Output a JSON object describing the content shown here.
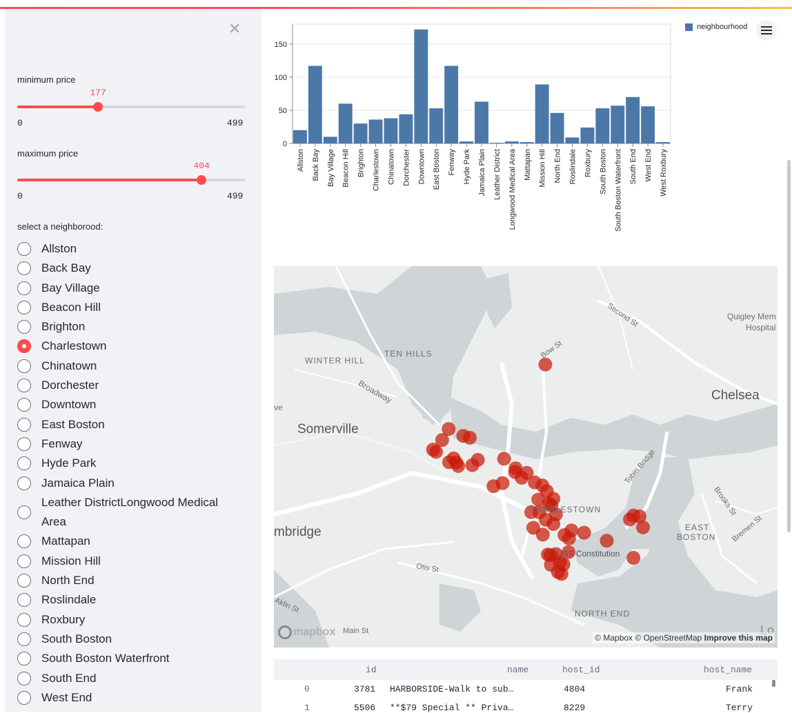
{
  "sidebar": {
    "close_icon": "close-x",
    "min_price": {
      "label": "minimum price",
      "value": 177,
      "min": 0,
      "max": 499,
      "value_text": "177",
      "min_text": "0",
      "max_text": "499"
    },
    "max_price": {
      "label": "maximum price",
      "value": 404,
      "min": 0,
      "max": 499,
      "value_text": "404",
      "min_text": "0",
      "max_text": "499"
    },
    "neighborhood_label": "select a neighborood:",
    "neighborhoods": [
      {
        "label": "Allston",
        "selected": false
      },
      {
        "label": "Back Bay",
        "selected": false
      },
      {
        "label": "Bay Village",
        "selected": false
      },
      {
        "label": "Beacon Hill",
        "selected": false
      },
      {
        "label": "Brighton",
        "selected": false
      },
      {
        "label": "Charlestown",
        "selected": true
      },
      {
        "label": "Chinatown",
        "selected": false
      },
      {
        "label": "Dorchester",
        "selected": false
      },
      {
        "label": "Downtown",
        "selected": false
      },
      {
        "label": "East Boston",
        "selected": false
      },
      {
        "label": "Fenway",
        "selected": false
      },
      {
        "label": "Hyde Park",
        "selected": false
      },
      {
        "label": "Jamaica Plain",
        "selected": false
      },
      {
        "label": "Leather DistrictLongwood Medical Area",
        "selected": false
      },
      {
        "label": "Mattapan",
        "selected": false
      },
      {
        "label": "Mission Hill",
        "selected": false
      },
      {
        "label": "North End",
        "selected": false
      },
      {
        "label": "Roslindale",
        "selected": false
      },
      {
        "label": "Roxbury",
        "selected": false
      },
      {
        "label": "South Boston",
        "selected": false
      },
      {
        "label": "South Boston Waterfront",
        "selected": false
      },
      {
        "label": "South End",
        "selected": false
      },
      {
        "label": "West End",
        "selected": false
      }
    ]
  },
  "chart_data": {
    "type": "bar",
    "categories": [
      "Allston",
      "Back Bay",
      "Bay Village",
      "Beacon Hill",
      "Brighton",
      "Charlestown",
      "Chinatown",
      "Dorchester",
      "Downtown",
      "East Boston",
      "Fenway",
      "Hyde Park",
      "Jamaica Plain",
      "Leather District",
      "Longwood Medical Area",
      "Mattapan",
      "Mission Hill",
      "North End",
      "Roslindale",
      "Roxbury",
      "South Boston",
      "South Boston Waterfront",
      "South End",
      "West End",
      "West Roxbury"
    ],
    "values": [
      20,
      117,
      10,
      60,
      30,
      36,
      38,
      44,
      172,
      53,
      117,
      3,
      63,
      1,
      3,
      2,
      89,
      46,
      9,
      24,
      53,
      57,
      70,
      56,
      2
    ],
    "yticks": [
      0,
      50,
      100,
      150
    ],
    "ylim": [
      0,
      180
    ],
    "legend": [
      "neighbourhood"
    ],
    "legend_position": "top-right",
    "color": "#4c78a8",
    "grid": true
  },
  "menu_icon": "hamburger-menu",
  "map": {
    "labels": {
      "tenhills": "TEN HILLS",
      "winterhill": "WINTER HILL",
      "broadway": "Broadway",
      "somerville": "Somerville",
      "bowst": "Bow St",
      "secondst": "Second St",
      "quigley1": "Quigley Mem",
      "quigley2": "Hospital",
      "chelsea": "Chelsea",
      "tobin": "Tobin Bridge",
      "charlestown": "CHARLESTOWN",
      "eastboston1": "EAST",
      "eastboston2": "BOSTON",
      "brooks": "Brooks St",
      "bremen": "Bremen St",
      "cambridge": "mbridge",
      "ussconst": "USS Constitution",
      "otis": "Otis St",
      "northend": "NORTH END",
      "mainst": "Main St",
      "klin": "Aklin St",
      "ve": "ve",
      "mapbox": "mapbox",
      "lo": "Lo"
    },
    "attribution": {
      "mapbox": "© Mapbox",
      "osm": "© OpenStreetMap",
      "improve": "Improve this map"
    },
    "point_color": "#c91a09",
    "points": [
      [
        0.539,
        0.258
      ],
      [
        0.347,
        0.427
      ],
      [
        0.334,
        0.456
      ],
      [
        0.316,
        0.481
      ],
      [
        0.322,
        0.487
      ],
      [
        0.376,
        0.445
      ],
      [
        0.389,
        0.45
      ],
      [
        0.348,
        0.514
      ],
      [
        0.362,
        0.515
      ],
      [
        0.366,
        0.524
      ],
      [
        0.357,
        0.504
      ],
      [
        0.394,
        0.522
      ],
      [
        0.405,
        0.508
      ],
      [
        0.457,
        0.505
      ],
      [
        0.48,
        0.53
      ],
      [
        0.479,
        0.54
      ],
      [
        0.502,
        0.542
      ],
      [
        0.492,
        0.555
      ],
      [
        0.436,
        0.577
      ],
      [
        0.454,
        0.569
      ],
      [
        0.518,
        0.567
      ],
      [
        0.533,
        0.575
      ],
      [
        0.542,
        0.59
      ],
      [
        0.525,
        0.612
      ],
      [
        0.555,
        0.61
      ],
      [
        0.527,
        0.645
      ],
      [
        0.511,
        0.645
      ],
      [
        0.56,
        0.651
      ],
      [
        0.546,
        0.622
      ],
      [
        0.551,
        0.627
      ],
      [
        0.515,
        0.686
      ],
      [
        0.555,
        0.676
      ],
      [
        0.54,
        0.665
      ],
      [
        0.577,
        0.705
      ],
      [
        0.586,
        0.714
      ],
      [
        0.591,
        0.693
      ],
      [
        0.616,
        0.699
      ],
      [
        0.534,
        0.704
      ],
      [
        0.549,
        0.758
      ],
      [
        0.544,
        0.756
      ],
      [
        0.56,
        0.755
      ],
      [
        0.585,
        0.75
      ],
      [
        0.55,
        0.783
      ],
      [
        0.568,
        0.777
      ],
      [
        0.575,
        0.782
      ],
      [
        0.564,
        0.802
      ],
      [
        0.571,
        0.807
      ],
      [
        0.707,
        0.664
      ],
      [
        0.714,
        0.654
      ],
      [
        0.726,
        0.656
      ],
      [
        0.733,
        0.685
      ],
      [
        0.714,
        0.765
      ],
      [
        0.661,
        0.72
      ]
    ]
  },
  "table": {
    "columns": [
      "id",
      "name",
      "host_id",
      "host_name"
    ],
    "rows": [
      {
        "index": "0",
        "id": "3781",
        "name": "HARBORSIDE-Walk to sub…",
        "host_id": "4804",
        "host_name": "Frank"
      },
      {
        "index": "1",
        "id": "5506",
        "name": "**$79 Special ** Priva…",
        "host_id": "8229",
        "host_name": "Terry"
      }
    ]
  }
}
